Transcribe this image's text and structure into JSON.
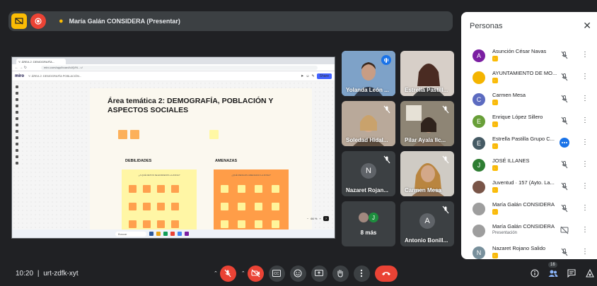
{
  "presenting_bar": {
    "presenter_name": "María Galán CONSIDERA (Presentar)",
    "stop_share_icon": "screen-share-off-icon",
    "record_icon": "record-icon"
  },
  "shared_screen": {
    "browser_tab": "Y: ÁREA 2: DEMOGRAFÍA...",
    "url": "miro.com/app/board/uXjVN...=/",
    "miro_logo": "miro",
    "board_name": "Y: ÁREA 2: DEMOGRAFÍA POBLACIÓN...",
    "frame_label": "Frame 2",
    "share_label": "Share",
    "frame_title": "Área temática 2: DEMOGRAFÍA, POBLACIÓN Y ASPECTOS SOCIALES",
    "col1_label": "DEBILIDADES",
    "col2_label": "AMENAZAS",
    "col1_head": "¿A QUÉ RETOS SE ENFRENTA LA ZONA?",
    "col2_head": "¿QUÉ RIESGOS AMENAZAN LA ZONA?",
    "zoom": "66 %",
    "taskbar_search": "Buscar"
  },
  "tiles": [
    {
      "name": "Yolanda León ...",
      "speaking": true
    },
    {
      "name": "Estrella Pastill...",
      "muted": false
    },
    {
      "name": "Soledad Hidal...",
      "muted": true
    },
    {
      "name": "Pilar Ayala Ilc...",
      "muted": true
    },
    {
      "name": "Nazaret Rojan...",
      "initial": "N",
      "muted": true
    },
    {
      "name": "Carmen Mesa",
      "muted": true
    },
    {
      "name": "8 más",
      "initial": "J"
    },
    {
      "name": "Antonio Bonill...",
      "initial": "A",
      "muted": true
    }
  ],
  "bottom_bar": {
    "time": "10:20",
    "separator": "|",
    "meeting_code": "urt-zdfk-xyt",
    "participant_count": "16"
  },
  "people_panel": {
    "title": "Personas",
    "people": [
      {
        "name": "Asunción César Navas",
        "initial": "A",
        "color": "#7b1fa2",
        "hand": true
      },
      {
        "name": "AYUNTAMIENTO DE MO...",
        "initial": "",
        "color": "#f4b400",
        "hand": true
      },
      {
        "name": "Carmen Mesa",
        "initial": "C",
        "color": "#5c6bc0",
        "hand": true
      },
      {
        "name": "Enrique López Sillero",
        "initial": "E",
        "color": "#689f38",
        "hand": true
      },
      {
        "name": "Estrella Pastilla Grupo C...",
        "initial": "E",
        "color": "#455a64",
        "hand": true,
        "speaking": true
      },
      {
        "name": "JOSÉ ILLANES",
        "initial": "J",
        "color": "#2e7d32",
        "hand": true
      },
      {
        "name": "Juventud · 157 (Ayto. La...",
        "initial": "",
        "color": "#795548",
        "hand": true
      },
      {
        "name": "María Galán CONSIDERA",
        "initial": "",
        "color": "#9e9e9e",
        "hand": true
      },
      {
        "name": "María Galán CONSIDERA",
        "sub": "Presentación",
        "initial": "",
        "color": "#9e9e9e",
        "hand": false
      },
      {
        "name": "Nazaret Rojano Salido",
        "initial": "N",
        "color": "#78909c",
        "hand": true
      }
    ]
  }
}
